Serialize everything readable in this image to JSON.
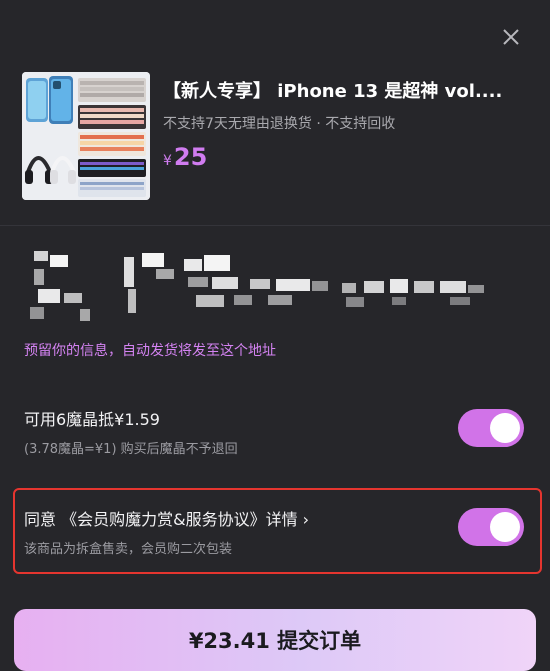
{
  "product": {
    "title": "【新人专享】 iPhone 13 是超神 vol....",
    "subtitle": "不支持7天无理由退换货 · 不支持回收",
    "price_currency": "¥",
    "price": "25"
  },
  "address": {
    "note": "预留你的信息，自动发货将发至这个地址"
  },
  "points": {
    "title": "可用6魔晶抵¥1.59",
    "subtitle": "(3.78魔晶=¥1) 购买后魔晶不予退回",
    "toggle_on": true
  },
  "agreement": {
    "title": "同意 《会员购魔力赏&服务协议》详情 ›",
    "subtitle": "该商品为拆盒售卖，会员购二次包装",
    "toggle_on": true
  },
  "submit": {
    "label": "¥23.41 提交订单"
  },
  "colors": {
    "background": "#26262a",
    "accent": "#d173e8",
    "highlight_border": "#e5352f"
  }
}
